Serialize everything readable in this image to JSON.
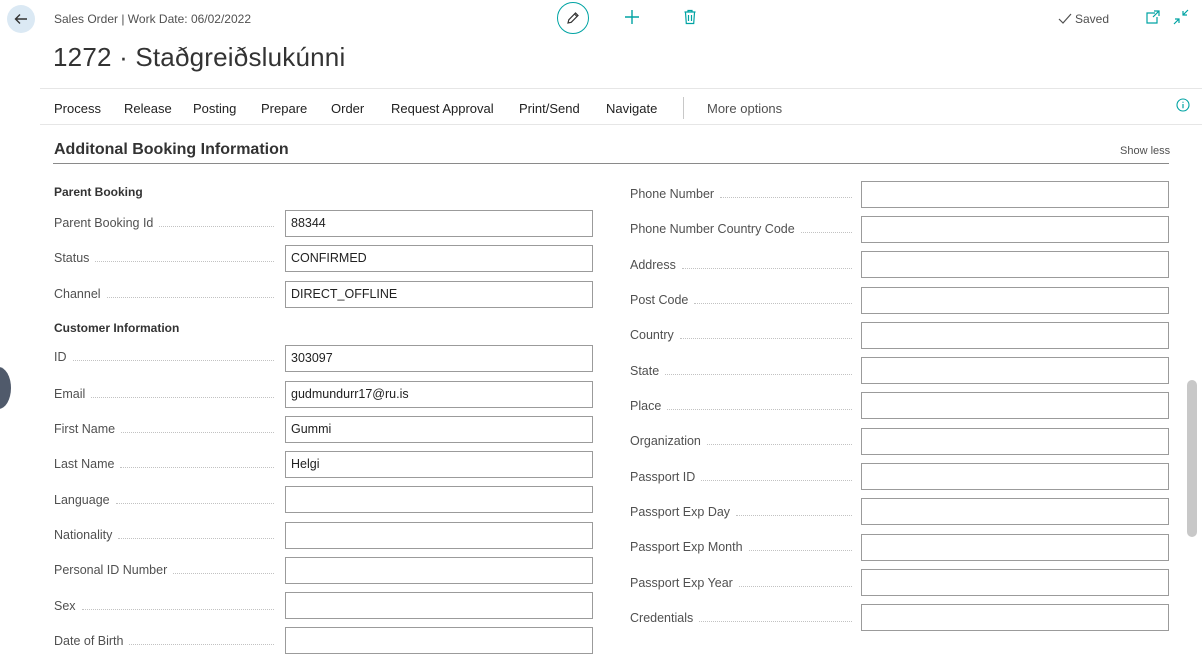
{
  "header": {
    "caption": "Sales Order | Work Date: 06/02/2022",
    "title": "1272 · Staðgreiðslukúnni",
    "saved_label": "Saved"
  },
  "actions": [
    {
      "label": "Process"
    },
    {
      "label": "Release"
    },
    {
      "label": "Posting"
    },
    {
      "label": "Prepare"
    },
    {
      "label": "Order"
    },
    {
      "label": "Request Approval"
    },
    {
      "label": "Print/Send"
    },
    {
      "label": "Navigate"
    },
    {
      "label": "More options"
    }
  ],
  "section": {
    "title": "Additonal Booking Information",
    "toggle_label": "Show less"
  },
  "parent_booking": {
    "title": "Parent Booking",
    "fields": [
      {
        "label": "Parent Booking Id",
        "value": "88344"
      },
      {
        "label": "Status",
        "value": "CONFIRMED"
      },
      {
        "label": "Channel",
        "value": "DIRECT_OFFLINE"
      }
    ]
  },
  "customer_info": {
    "title": "Customer Information",
    "fields": [
      {
        "label": "ID",
        "value": "303097"
      },
      {
        "label": "Email",
        "value": "gudmundurr17@ru.is"
      },
      {
        "label": "First Name",
        "value": "Gummi"
      },
      {
        "label": "Last Name",
        "value": "Helgi"
      },
      {
        "label": "Language",
        "value": ""
      },
      {
        "label": "Nationality",
        "value": ""
      },
      {
        "label": "Personal ID Number",
        "value": ""
      },
      {
        "label": "Sex",
        "value": ""
      },
      {
        "label": "Date of Birth",
        "value": ""
      }
    ]
  },
  "right_fields": [
    {
      "label": "Phone Number",
      "value": ""
    },
    {
      "label": "Phone Number Country Code",
      "value": ""
    },
    {
      "label": "Address",
      "value": ""
    },
    {
      "label": "Post Code",
      "value": ""
    },
    {
      "label": "Country",
      "value": ""
    },
    {
      "label": "State",
      "value": ""
    },
    {
      "label": "Place",
      "value": ""
    },
    {
      "label": "Organization",
      "value": ""
    },
    {
      "label": "Passport ID",
      "value": ""
    },
    {
      "label": "Passport Exp Day",
      "value": ""
    },
    {
      "label": "Passport Exp Month",
      "value": ""
    },
    {
      "label": "Passport Exp Year",
      "value": ""
    },
    {
      "label": "Credentials",
      "value": ""
    }
  ],
  "icons": {
    "back": "back-arrow-icon",
    "edit": "pencil-icon",
    "new": "plus-icon",
    "delete": "trash-icon",
    "saved": "checkmark-icon",
    "open_new": "open-in-new-window-icon",
    "collapse": "collapse-icon",
    "info": "info-icon"
  },
  "colors": {
    "accent": "#00a3a3",
    "back_bg": "#dbe9f4",
    "input_border": "#9b9b9b"
  }
}
